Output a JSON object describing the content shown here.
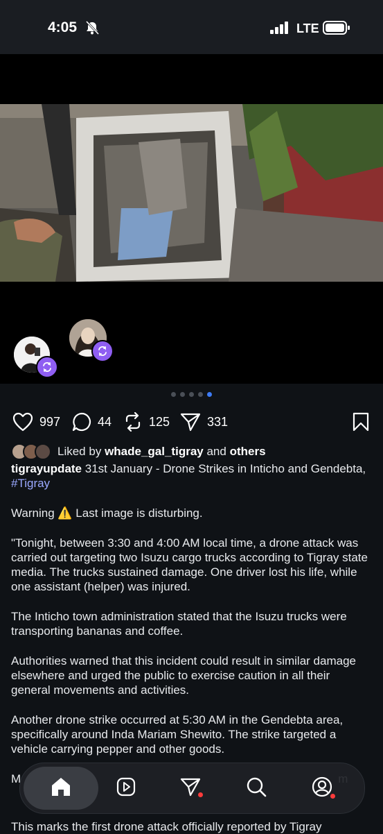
{
  "status_bar": {
    "time": "4:05",
    "network": "LTE"
  },
  "post": {
    "carousel": {
      "total_pages": 5,
      "active_page": 5
    },
    "stats": {
      "likes": "997",
      "comments": "44",
      "reposts": "125",
      "shares": "331"
    },
    "liked_by": {
      "prefix": "Liked by",
      "user": "whade_gal_tigray",
      "and": "and",
      "others": "others"
    },
    "author": "tigrayupdate",
    "headline": " 31st January - Drone Strikes in Inticho and Gendebta, ",
    "hashtag": "#Tigray",
    "paragraphs": [
      "Warning ⚠️ Last image is disturbing.",
      "\"Tonight, between 3:30 and 4:00 AM local time, a drone attack was carried out targeting two Isuzu cargo trucks according to Tigray state media. The trucks sustained damage. One driver lost his life, while one assistant (helper) was injured.",
      "The Inticho town administration stated that the Isuzu trucks were transporting bananas and coffee.",
      "Authorities warned that this incident could result in similar damage elsewhere and urged the public to exercise caution in all their general movements and activities.",
      "Another drone strike occurred at 5:30 AM in the Gendebta area, specifically around Inda Mariam Shewito. The strike targeted a vehicle carrying pepper and other goods.",
      "M                                                                                                 m"
    ],
    "trailing_text": "This marks the first drone attack officially reported by Tigray"
  },
  "nav": {
    "items": [
      "home",
      "reels",
      "messages",
      "search",
      "profile"
    ]
  },
  "colors": {
    "accent": "#8f5ef2",
    "link": "#9aa8ff",
    "active_dot": "#3d7bf5",
    "notification": "#ff3b3b"
  }
}
